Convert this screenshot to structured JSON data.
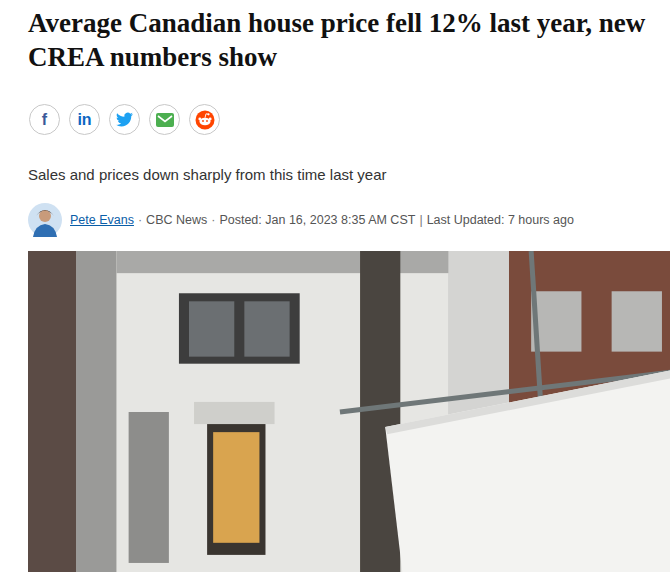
{
  "article": {
    "headline": "Average Canadian house price fell 12% last year, new CREA numbers show",
    "share_buttons": [
      {
        "kind": "glyph",
        "glyph": "f",
        "color": "#3b5998"
      },
      {
        "kind": "glyph",
        "glyph": "in",
        "color": "#0a66c2"
      },
      {
        "kind": "twitter",
        "color": "#1da1f2"
      },
      {
        "kind": "mail",
        "color": "#4caf50"
      },
      {
        "kind": "reddit",
        "color": "#ff4500"
      }
    ],
    "subtitle": "Sales and prices down sharply from this time last year",
    "byline": {
      "author": "Pete Evans",
      "parts": [
        {
          "sep": "·",
          "text": "CBC News"
        },
        {
          "sep": "·",
          "text": "Posted: Jan 16, 2023 8:35 AM CST"
        },
        {
          "sep": "|",
          "text": "Last Updated: 7 hours ago"
        }
      ]
    }
  }
}
